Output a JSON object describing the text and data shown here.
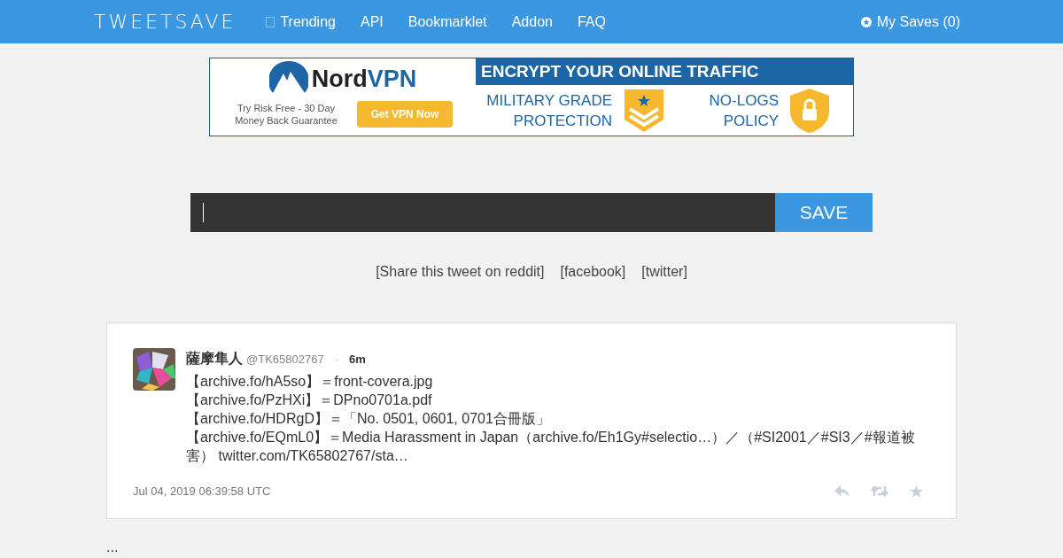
{
  "navbar": {
    "logo": "TWEETSAVE",
    "links": [
      {
        "label": "Trending",
        "icon": true
      },
      {
        "label": "API",
        "icon": false
      },
      {
        "label": "Bookmarklet",
        "icon": false
      },
      {
        "label": "Addon",
        "icon": false
      },
      {
        "label": "FAQ",
        "icon": false
      }
    ],
    "my_saves": "My Saves (0)"
  },
  "ad": {
    "brand_a": "Nord",
    "brand_b": "VPN",
    "tagline": "Try Risk Free - 30 Day Money Back Guarantee",
    "cta": "Get VPN Now",
    "headline": "ENCRYPT YOUR ONLINE TRAFFIC",
    "feature_1": "MILITARY GRADE PROTECTION",
    "feature_2": "NO-LOGS POLICY"
  },
  "save_form": {
    "button": "SAVE"
  },
  "share_links": [
    "[Share this tweet on reddit]",
    "[facebook]",
    "[twitter]"
  ],
  "tweet": {
    "name": "薩摩隼人",
    "handle": "@TK65802767",
    "separator": "·",
    "age": "6m",
    "lines": [
      "【archive.fo/hA5so】＝front-covera.jpg",
      "【archive.fo/PzHXi】＝DPno0701a.pdf",
      "【archive.fo/HDRgD】＝「No. 0501, 0601, 0701合冊版」",
      "【archive.fo/EQmL0】＝Media Harassment in Japan（archive.fo/Eh1Gy#selectio…）／（#SI2001／#SI3／#報道被害） twitter.com/TK65802767/sta…"
    ],
    "timestamp": "Jul 04, 2019 06:39:58 UTC"
  },
  "footer_text": "..."
}
